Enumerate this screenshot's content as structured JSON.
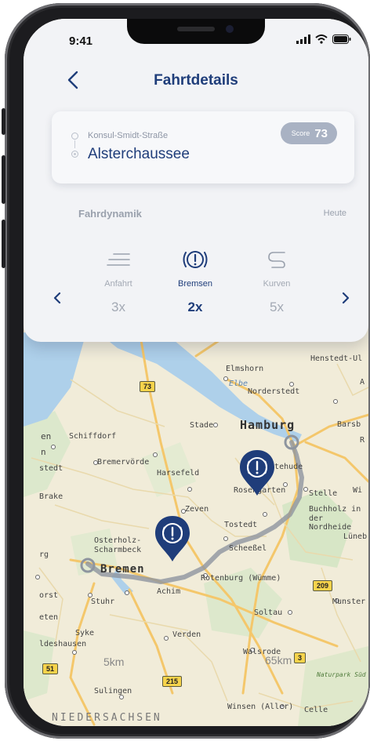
{
  "status_bar": {
    "time": "9:41"
  },
  "header": {
    "title": "Fahrtdetails"
  },
  "route": {
    "from": "Konsul-Smidt-Straße",
    "to": "Alsterchaussee",
    "score_label": "Score",
    "score_value": "73"
  },
  "dynamics": {
    "label": "Fahrdynamik",
    "period": "Heute",
    "metrics": [
      {
        "name": "Anfahrt",
        "count": "3x",
        "icon": "acceleration-lines-icon"
      },
      {
        "name": "Bremsen",
        "count": "2x",
        "icon": "brake-warning-icon"
      },
      {
        "name": "Kurven",
        "count": "5x",
        "icon": "curve-icon"
      }
    ],
    "selected": "Bremsen"
  },
  "map": {
    "labels": {
      "elmshorn": "Elmshorn",
      "elbe": "Elbe",
      "norderstedt": "Norderstedt",
      "henstedt": "Henstedt-Ul",
      "schiffdorf": "Schiffdorf",
      "stade": "Stade",
      "hamburg": "Hamburg",
      "barsb": "Barsb",
      "bremervoerde": "Bremervörde",
      "harsefeld": "Harsefeld",
      "buxtehude": "Buxtehude",
      "stedt": "stedt",
      "rosengarten": "Rosengarten",
      "stelle": "Stelle",
      "brake": "Brake",
      "zeven": "Zeven",
      "tostedt": "Tostedt",
      "buchholz": "Buchholz in",
      "nordheide": "der Nordheide",
      "lueneb": "Lüneb",
      "osterholz": "Osterholz-",
      "scharmbeck": "Scharmbeck",
      "scheessel": "Scheeßel",
      "bremen": "Bremen",
      "achim": "Achim",
      "rotenburg": "Rotenburg (Wümme)",
      "orst": "orst",
      "stuhr": "Stuhr",
      "munster": "Munster",
      "eten": "eten",
      "syke": "Syke",
      "soltau": "Soltau",
      "verden": "Verden",
      "ldeshausen": "ldeshausen",
      "walsrode": "Walsrode",
      "sulingen": "Sulingen",
      "winsen": "Winsen (Aller)",
      "celle": "Celle",
      "naturpark": "Naturpark Süd",
      "niedersachsen": "NIEDERSACHSEN",
      "scale_left": "5km",
      "scale_right": "65km",
      "en": "en",
      "n": "n",
      "rg": "rg",
      "wi": "Wi",
      "r": "R",
      "a": "A"
    },
    "road_shields": [
      "73",
      "209",
      "51",
      "215",
      "3"
    ]
  }
}
